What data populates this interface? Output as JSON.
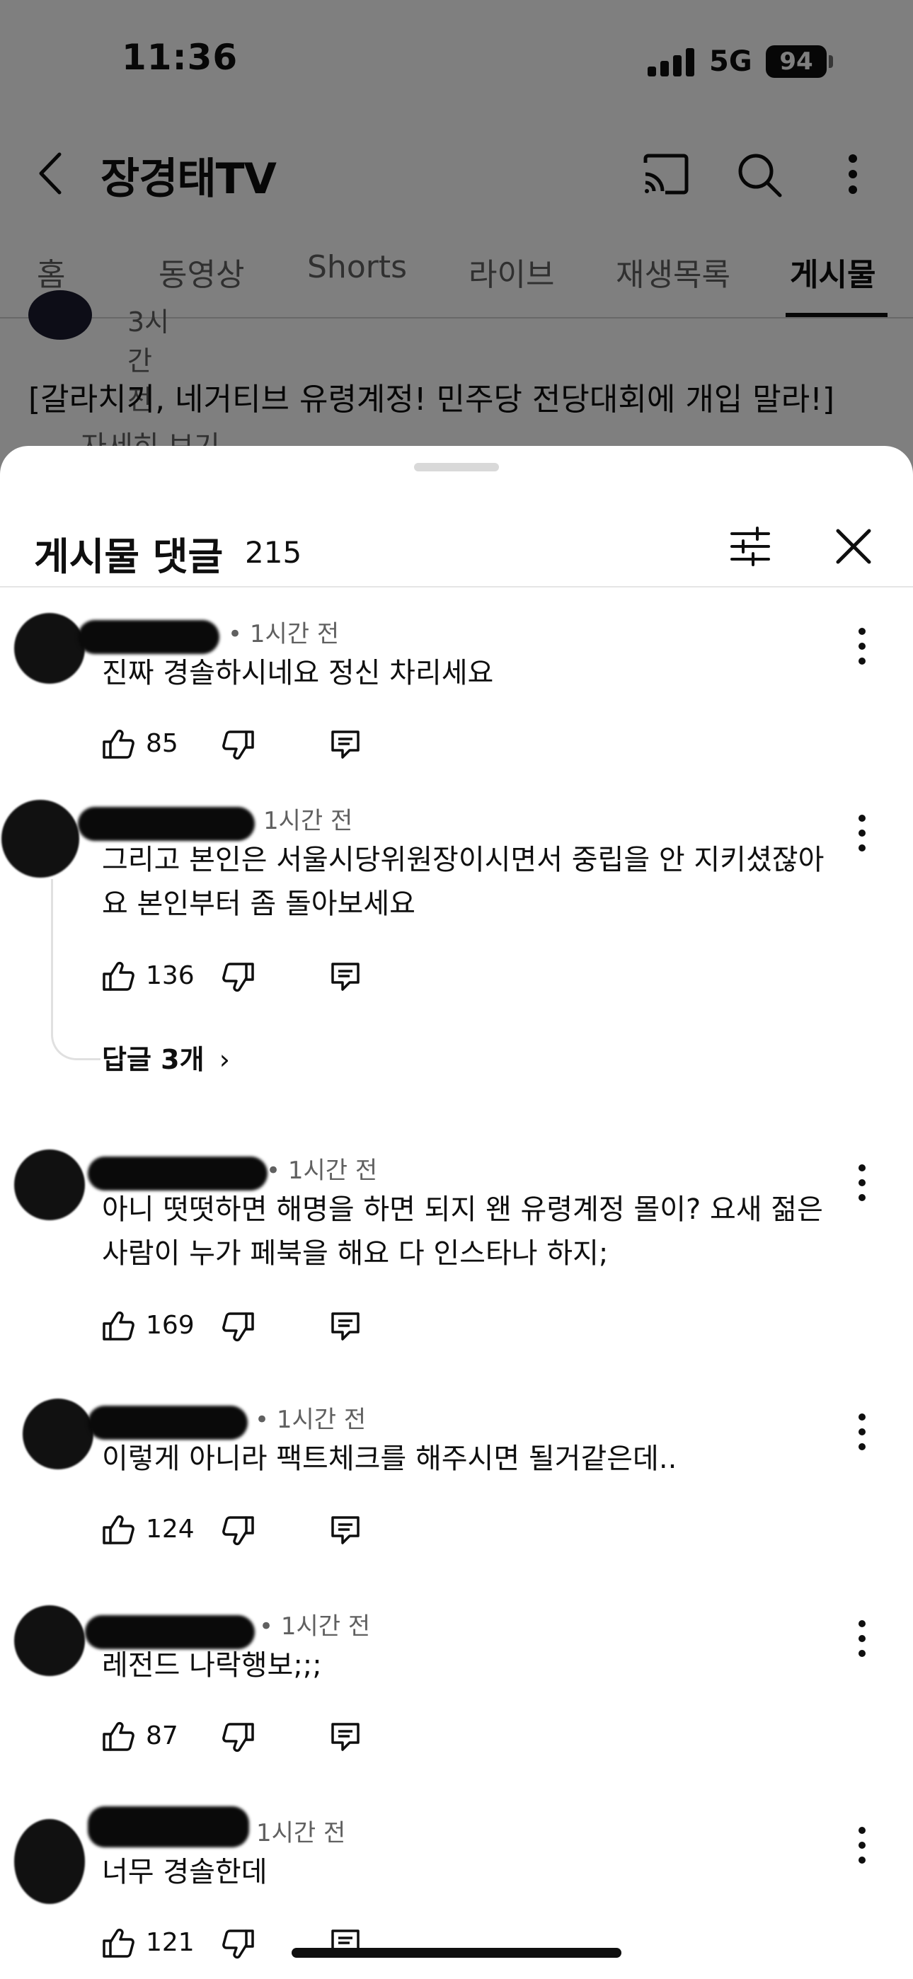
{
  "status_bar": {
    "time": "11:36",
    "network": "5G",
    "battery": "94"
  },
  "header": {
    "title": "장경태TV"
  },
  "tabs": [
    {
      "label": "홈",
      "active": false
    },
    {
      "label": "동영상",
      "active": false
    },
    {
      "label": "Shorts",
      "active": false
    },
    {
      "label": "라이브",
      "active": false
    },
    {
      "label": "재생목록",
      "active": false
    },
    {
      "label": "게시물",
      "active": true
    }
  ],
  "post": {
    "time": "3시간 전",
    "text": "[갈라치기, 네거티브 유령계정! 민주당 전당대회에 개입 말라!]",
    "more_label": "...자세히 보기"
  },
  "sheet": {
    "title": "게시물 댓글",
    "count": "215"
  },
  "comments": [
    {
      "time": "• 1시간 전",
      "text": "진짜 경솔하시네요 정신 차리세요",
      "likes": "85"
    },
    {
      "time": "1시간 전",
      "text": "그리고 본인은 서울시당위원장이시면서 중립을 안 지키셨잖아요 본인부터 좀 돌아보세요",
      "likes": "136",
      "replies": "답글 3개"
    },
    {
      "time": "• 1시간 전",
      "text": "아니 떳떳하면 해명을 하면 되지 왠 유령계정 몰이? 요새 젊은사람이 누가 페북을 해요 다 인스타나 하지;",
      "likes": "169"
    },
    {
      "time": "• 1시간 전",
      "text": "이렇게 아니라 팩트체크를 해주시면 될거같은데..",
      "likes": "124"
    },
    {
      "time": "• 1시간 전",
      "text": "레전드 나락행보;;;",
      "likes": "87"
    },
    {
      "time": "1시간 전",
      "text": "너무 경솔한데",
      "likes": "121"
    }
  ],
  "colors": {
    "sheet_bg": "#ffffff",
    "overlay": "rgba(0,0,0,0.5)",
    "text_primary": "#0f0f0f",
    "text_secondary": "#606060"
  }
}
